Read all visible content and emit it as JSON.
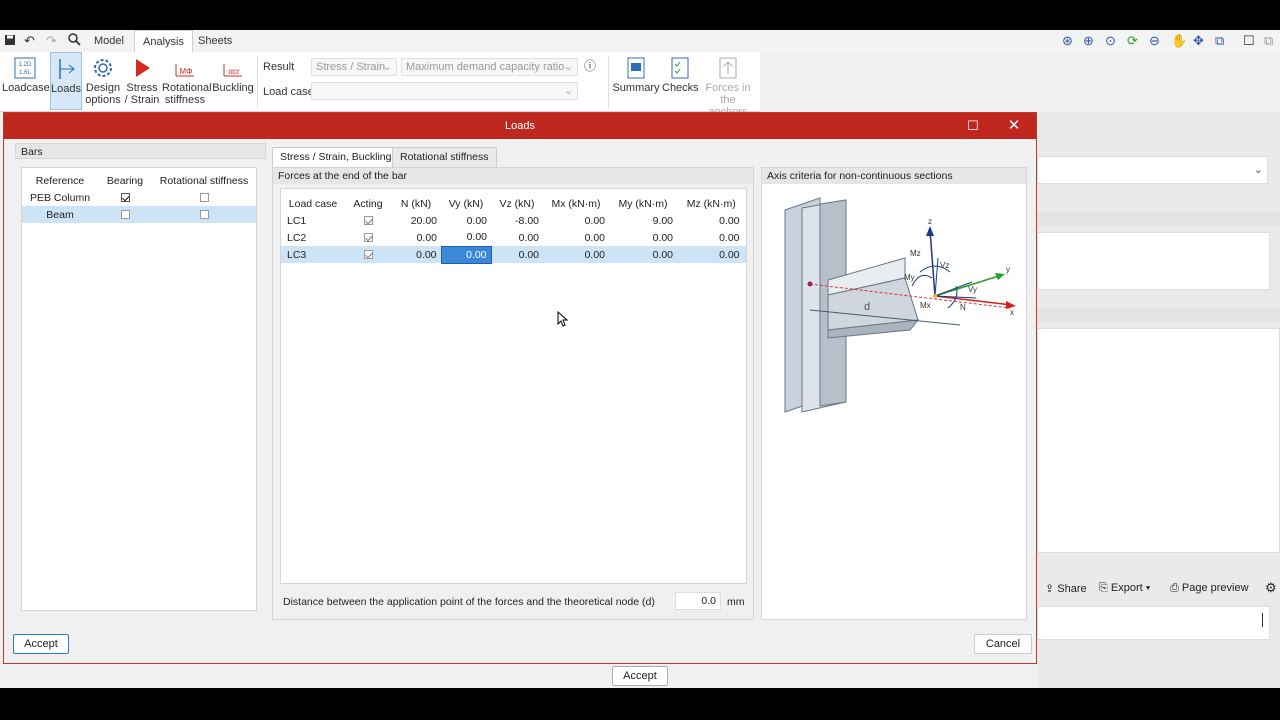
{
  "menu": {
    "tabs": [
      "Model",
      "Analysis",
      "Sheets"
    ],
    "active_tab": "Analysis"
  },
  "ribbon": {
    "loadcases": "Loadcases",
    "loads": "Loads",
    "design_1": "Design",
    "design_2": "options",
    "stress_1": "Stress",
    "stress_2": "/ Strain",
    "rot_1": "Rotational",
    "rot_2": "stiffness",
    "buckling": "Buckling",
    "result_label": "Result",
    "result_value": "Stress / Strain",
    "result_metric": "Maximum demand capacity ratio",
    "loadcase_label": "Load case",
    "summary": "Summary",
    "checks": "Checks",
    "forces_1": "Forces in",
    "forces_2": "the anchors"
  },
  "right_panel": {
    "share": "Share",
    "export": "Export",
    "page_preview": "Page preview"
  },
  "dialog": {
    "title": "Loads",
    "bars_panel": {
      "title": "Bars",
      "headers": [
        "Reference",
        "Bearing",
        "Rotational stiffness"
      ],
      "rows": [
        {
          "reference": "PEB Column",
          "bearing": true,
          "rotational": false
        },
        {
          "reference": "Beam",
          "bearing": false,
          "rotational": false
        }
      ]
    },
    "tabs": [
      "Stress / Strain, Buckling",
      "Rotational stiffness"
    ],
    "forces_panel": {
      "title": "Forces at the end of the bar",
      "headers": [
        "Load case",
        "Acting",
        "N (kN)",
        "Vy (kN)",
        "Vz (kN)",
        "Mx (kN·m)",
        "My (kN·m)",
        "Mz (kN·m)"
      ],
      "rows": [
        {
          "lc": "LC1",
          "acting": true,
          "n": "20.00",
          "vy": "0.00",
          "vz": "-8.00",
          "mx": "0.00",
          "my": "9.00",
          "mz": "0.00"
        },
        {
          "lc": "LC2",
          "acting": true,
          "n": "0.00",
          "vy": "0.00",
          "vz": "0.00",
          "mx": "0.00",
          "my": "0.00",
          "mz": "0.00"
        },
        {
          "lc": "LC3",
          "acting": true,
          "n": "0.00",
          "vy": "0.00",
          "vz": "0.00",
          "mx": "0.00",
          "my": "0.00",
          "mz": "0.00"
        }
      ],
      "distance_label": "Distance between the application point of the forces and the theoretical node (d)",
      "distance_value": "0.0",
      "distance_unit": "mm"
    },
    "axis_panel": {
      "title": "Axis criteria for non-continuous sections",
      "labels": {
        "z": "z",
        "mz": "Mz",
        "vz": "Vz",
        "my": "My",
        "y": "y",
        "vy": "Vy",
        "mx": "Mx",
        "n": "N",
        "x": "x",
        "d": "d"
      }
    },
    "accept": "Accept",
    "cancel": "Cancel"
  },
  "bottom_accept": "Accept",
  "colors": {
    "title_bar": "#c0281f",
    "selection": "#cde4f7",
    "cell_edit": "#3b88d8"
  }
}
